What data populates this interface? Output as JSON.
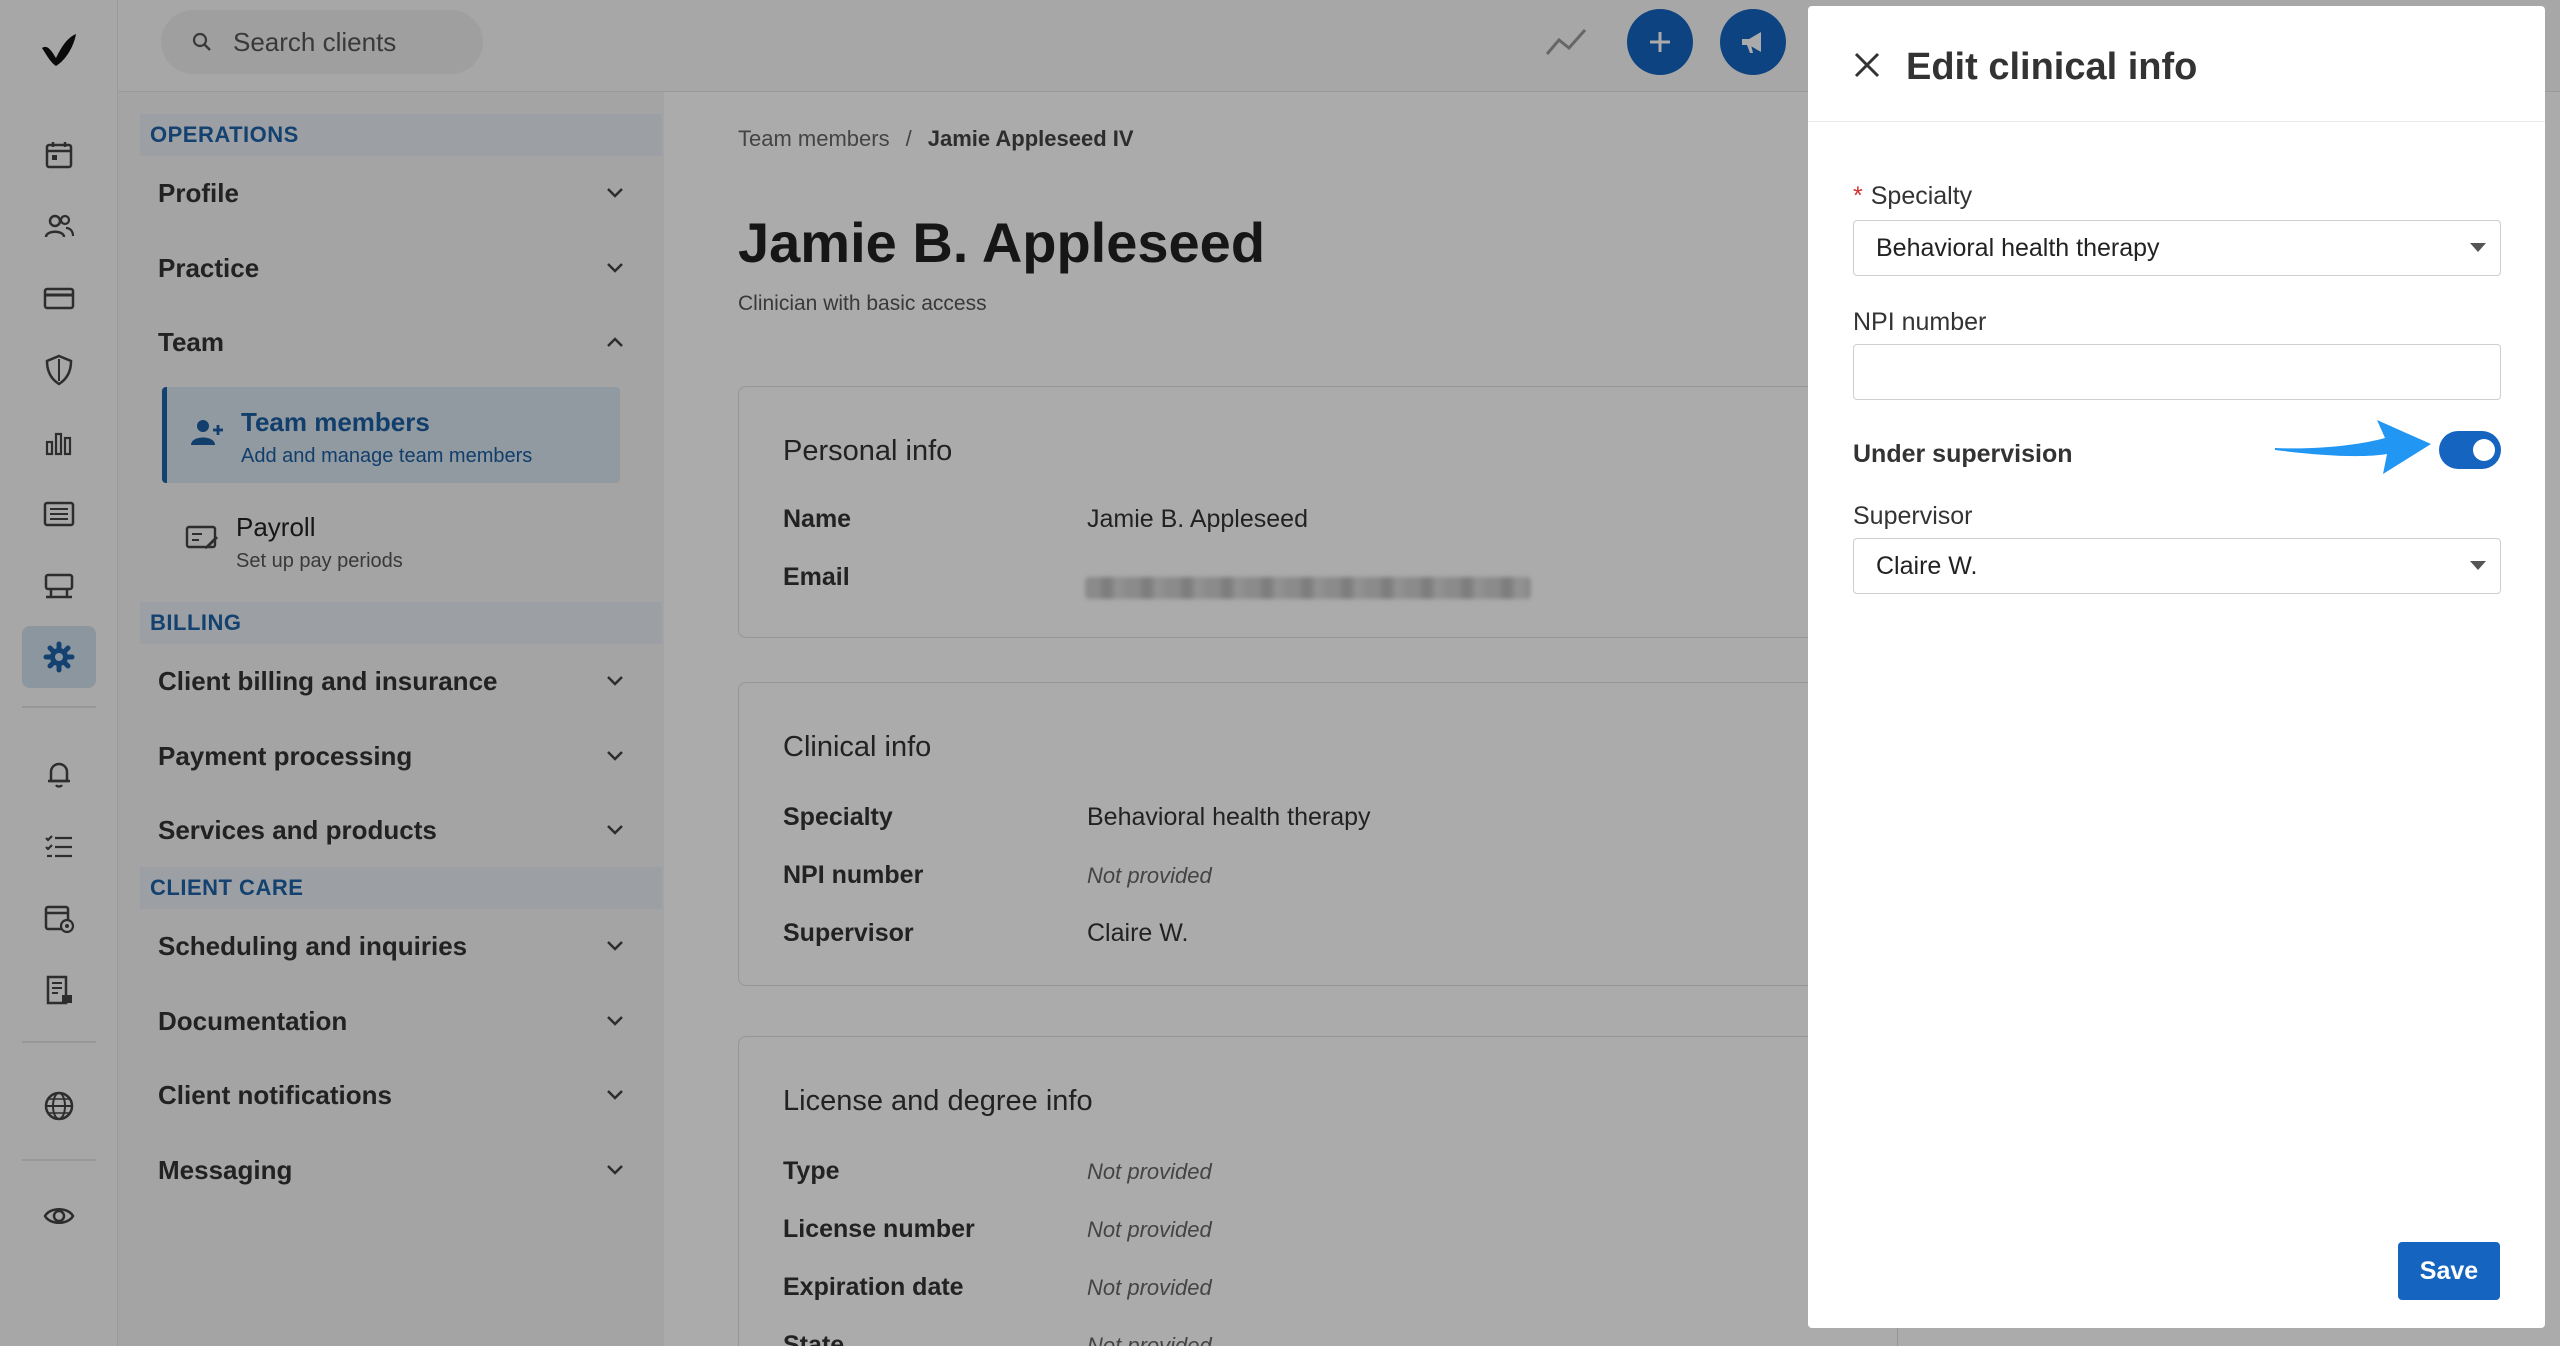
{
  "topbar": {
    "search_placeholder": "Search clients"
  },
  "settings_nav": {
    "sections": {
      "operations": "OPERATIONS",
      "billing": "BILLING",
      "client_care": "CLIENT CARE"
    },
    "items": {
      "profile": "Profile",
      "practice": "Practice",
      "team": "Team",
      "client_billing": "Client billing and insurance",
      "payment_processing": "Payment processing",
      "services_products": "Services and products",
      "scheduling": "Scheduling and inquiries",
      "documentation": "Documentation",
      "client_notifications": "Client notifications",
      "messaging": "Messaging"
    },
    "team_members": {
      "title": "Team members",
      "desc": "Add and manage team members"
    },
    "payroll": {
      "title": "Payroll",
      "desc": "Set up pay periods"
    }
  },
  "breadcrumb": {
    "parent": "Team members",
    "separator": "/",
    "current": "Jamie Appleseed IV"
  },
  "profile": {
    "name": "Jamie B. Appleseed",
    "role": "Clinician with basic access"
  },
  "personal_info": {
    "heading": "Personal info",
    "name_label": "Name",
    "name_value": "Jamie B. Appleseed",
    "email_label": "Email"
  },
  "clinical_info": {
    "heading": "Clinical info",
    "specialty_label": "Specialty",
    "specialty_value": "Behavioral health therapy",
    "npi_label": "NPI number",
    "npi_value": "Not provided",
    "supervisor_label": "Supervisor",
    "supervisor_value": "Claire W."
  },
  "license_info": {
    "heading": "License and degree info",
    "type_label": "Type",
    "type_value": "Not provided",
    "license_label": "License number",
    "license_value": "Not provided",
    "expiration_label": "Expiration date",
    "expiration_value": "Not provided",
    "state_label": "State",
    "state_value": "Not provided"
  },
  "drawer": {
    "title": "Edit clinical info",
    "specialty_label": "Specialty",
    "specialty_required": "*",
    "specialty_value": "Behavioral health therapy",
    "npi_label": "NPI number",
    "npi_value": "",
    "under_supervision_label": "Under supervision",
    "under_supervision_on": true,
    "supervisor_label": "Supervisor",
    "supervisor_value": "Claire W.",
    "save_label": "Save"
  },
  "colors": {
    "accent": "#1565c0",
    "nav_accent": "#1e63a8",
    "annotation_arrow": "#2196f3",
    "required": "#d32f2f"
  },
  "icons": {
    "rail": [
      "logo-icon",
      "calendar-icon",
      "clients-icon",
      "billing-card-icon",
      "insurance-shield-icon",
      "analytics-icon",
      "list-icon",
      "marketing-icon",
      "settings-gear-icon",
      "bell-icon",
      "tasks-icon",
      "calendar-settings-icon",
      "reports-icon",
      "globe-icon",
      "eye-icon"
    ]
  }
}
